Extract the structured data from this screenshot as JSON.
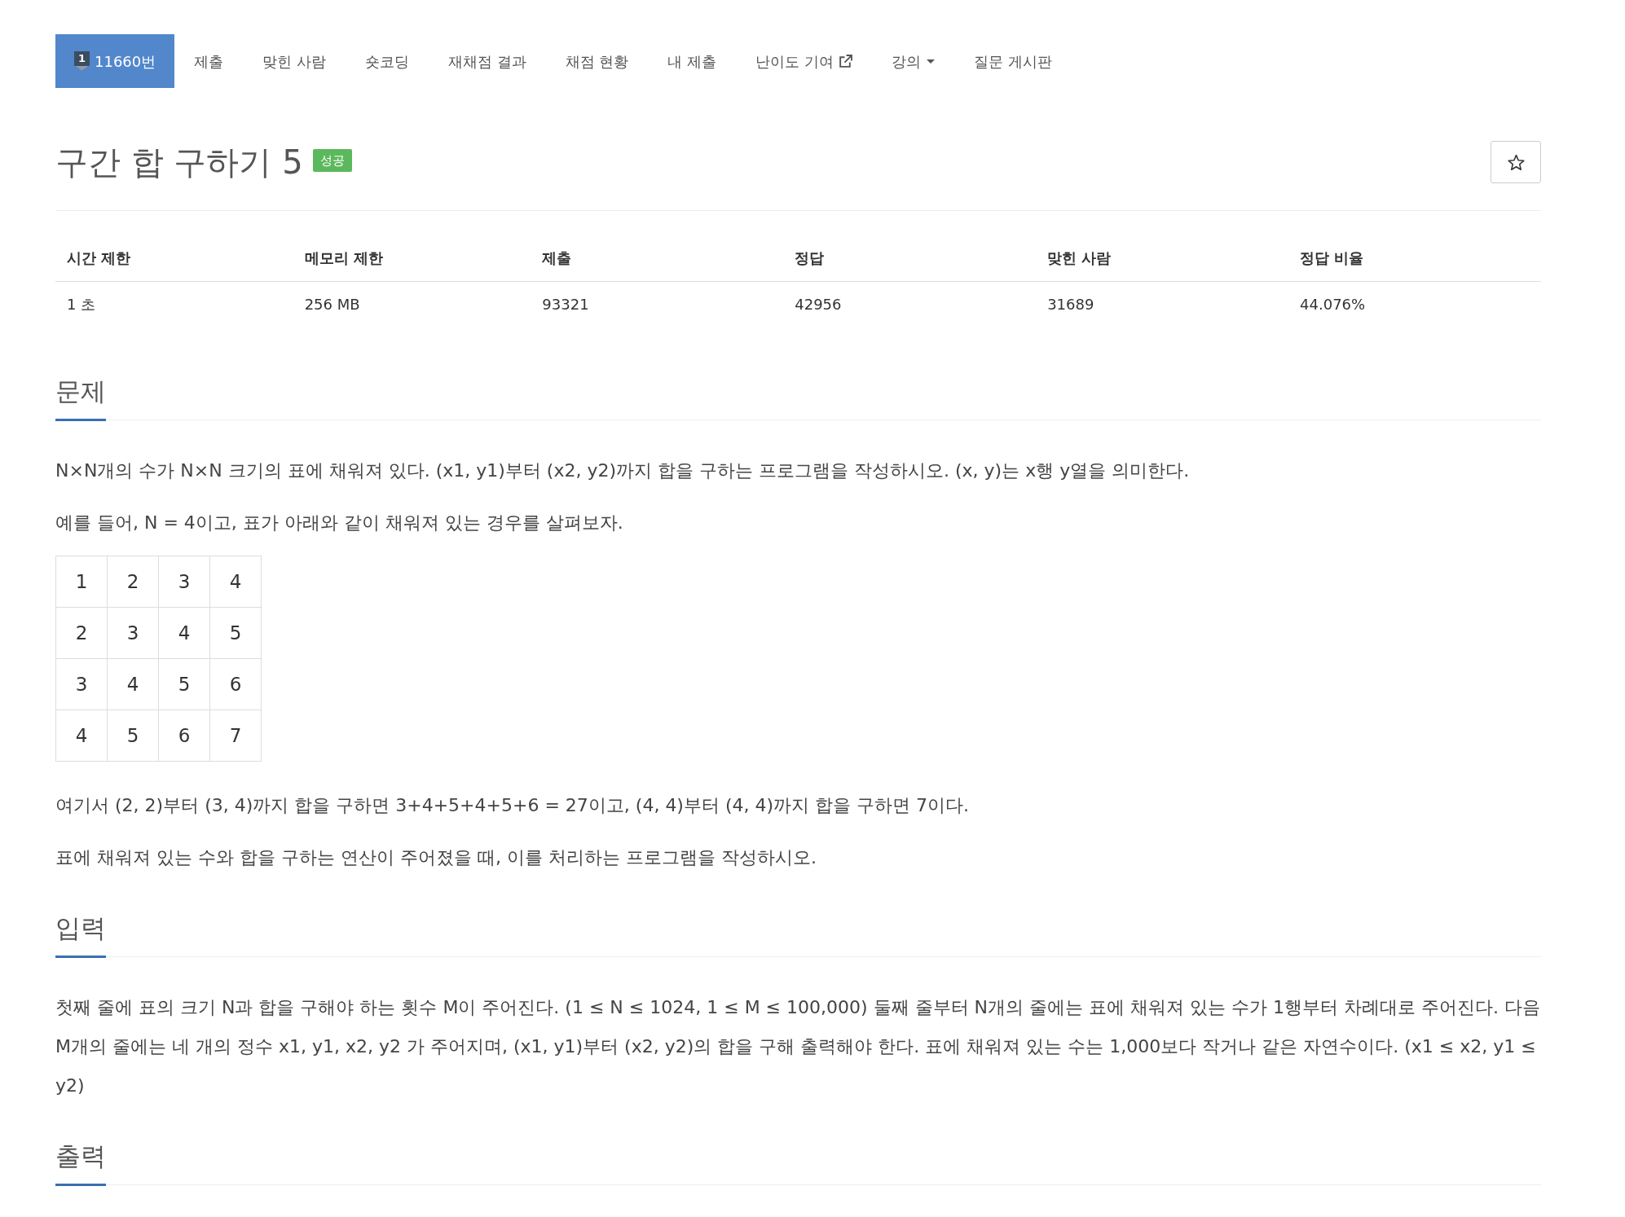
{
  "nav": {
    "tabs": [
      {
        "label": "11660번",
        "tier": "1",
        "selected": true,
        "kind": "link"
      },
      {
        "label": "제출",
        "selected": false,
        "kind": "link"
      },
      {
        "label": "맞힌 사람",
        "selected": false,
        "kind": "link"
      },
      {
        "label": "숏코딩",
        "selected": false,
        "kind": "link"
      },
      {
        "label": "재채점 결과",
        "selected": false,
        "kind": "link"
      },
      {
        "label": "채점 현황",
        "selected": false,
        "kind": "link"
      },
      {
        "label": "내 제출",
        "selected": false,
        "kind": "link"
      },
      {
        "label": "난이도 기여",
        "selected": false,
        "kind": "external"
      },
      {
        "label": "강의",
        "selected": false,
        "kind": "dropdown"
      },
      {
        "label": "질문 게시판",
        "selected": false,
        "kind": "link"
      }
    ]
  },
  "problem": {
    "title": "구간 합 구하기 5",
    "status_badge": "성공",
    "starred": false
  },
  "limits_table": {
    "columns": [
      "시간 제한",
      "메모리 제한",
      "제출",
      "정답",
      "맞힌 사람",
      "정답 비율"
    ],
    "rows": [
      [
        "1 초",
        "256 MB",
        "93321",
        "42956",
        "31689",
        "44.076%"
      ]
    ]
  },
  "sections": [
    {
      "title": "문제",
      "blocks": [
        {
          "kind": "paragraph",
          "text": "N×N개의 수가 N×N 크기의 표에 채워져 있다. (x1, y1)부터 (x2, y2)까지 합을 구하는 프로그램을 작성하시오. (x, y)는 x행 y열을 의미한다."
        },
        {
          "kind": "paragraph",
          "text": "예를 들어, N = 4이고, 표가 아래와 같이 채워져 있는 경우를 살펴보자."
        },
        {
          "kind": "grid",
          "rows": [
            [
              "1",
              "2",
              "3",
              "4"
            ],
            [
              "2",
              "3",
              "4",
              "5"
            ],
            [
              "3",
              "4",
              "5",
              "6"
            ],
            [
              "4",
              "5",
              "6",
              "7"
            ]
          ]
        },
        {
          "kind": "paragraph",
          "text": "여기서 (2, 2)부터 (3, 4)까지 합을 구하면 3+4+5+4+5+6 = 27이고, (4, 4)부터 (4, 4)까지 합을 구하면 7이다."
        },
        {
          "kind": "paragraph",
          "text": "표에 채워져 있는 수와 합을 구하는 연산이 주어졌을 때, 이를 처리하는 프로그램을 작성하시오."
        }
      ]
    },
    {
      "title": "입력",
      "blocks": [
        {
          "kind": "paragraph",
          "text": "첫째 줄에 표의 크기 N과 합을 구해야 하는 횟수 M이 주어진다. (1 ≤ N ≤ 1024, 1 ≤ M ≤ 100,000) 둘째 줄부터 N개의 줄에는 표에 채워져 있는 수가 1행부터 차례대로 주어진다. 다음 M개의 줄에는 네 개의 정수 x1, y1, x2, y2 가 주어지며, (x1, y1)부터 (x2, y2)의 합을 구해 출력해야 한다. 표에 채워져 있는 수는 1,000보다 작거나 같은 자연수이다. (x1 ≤ x2, y1 ≤ y2)"
        }
      ]
    },
    {
      "title": "출력"
    }
  ]
}
